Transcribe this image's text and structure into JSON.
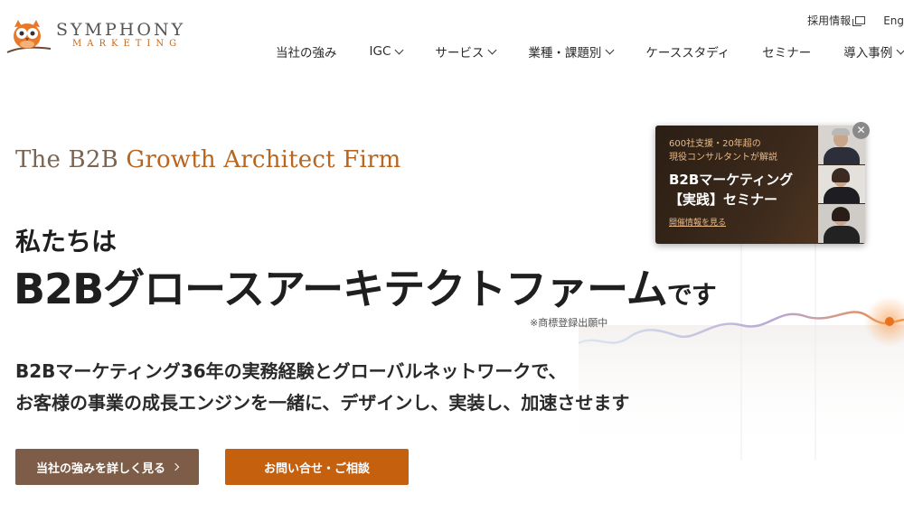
{
  "brand": {
    "name_main": "SYMPHONY",
    "name_sub": "MARKETING",
    "owl_color": "#e8792a"
  },
  "utility": {
    "recruit": "採用情報",
    "language": "Eng"
  },
  "nav": [
    {
      "label": "当社の強み",
      "dropdown": false
    },
    {
      "label": "IGC",
      "dropdown": true
    },
    {
      "label": "サービス",
      "dropdown": true
    },
    {
      "label": "業種・課題別",
      "dropdown": true
    },
    {
      "label": "ケーススタディ",
      "dropdown": false
    },
    {
      "label": "セミナー",
      "dropdown": false
    },
    {
      "label": "導入事例",
      "dropdown": true
    }
  ],
  "hero": {
    "tagline_prefix": "The B2B ",
    "tagline_accent": "Growth Architect Firm",
    "heading_small": "私たちは",
    "heading_big": "B2Bグロースアーキテクトファーム",
    "heading_suffix": "です",
    "trademark_note": "※商標登録出願中",
    "lead_line1": "B2Bマーケティング36年の実務経験とグローバルネットワークで、",
    "lead_line2": "お客様の事業の成長エンジンを一緒に、デザインし、実装し、加速させます"
  },
  "buttons": {
    "strengths": "当社の強みを詳しく見る",
    "contact": "お問い合せ・ご相談"
  },
  "seminar_card": {
    "sub_line1": "600社支援・20年超の",
    "sub_line2": "現役コンサルタントが解説",
    "title_line1": "B2Bマーケティング",
    "title_line2": "【実践】セミナー",
    "link": "開催情報を見る",
    "close": "✕"
  },
  "colors": {
    "accent_orange": "#c5600f",
    "button_brown": "#7d5c48",
    "tagline_brown": "#7a6552"
  }
}
